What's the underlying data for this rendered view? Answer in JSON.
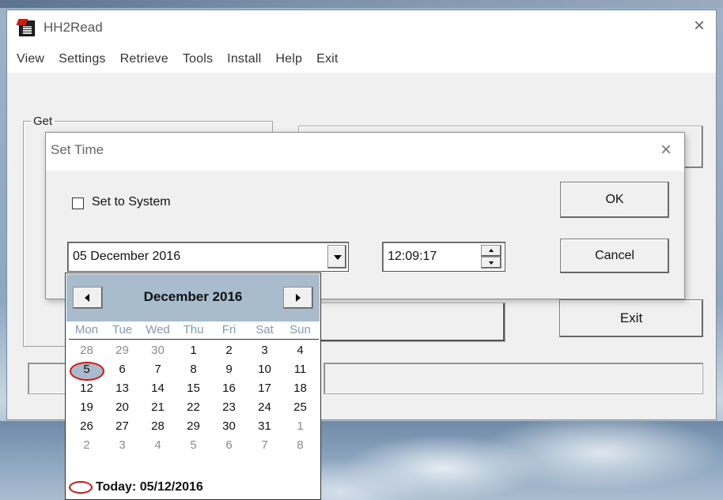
{
  "window": {
    "title": "HH2Read",
    "close_glyph": "×"
  },
  "menu": {
    "items": [
      "View",
      "Settings",
      "Retrieve",
      "Tools",
      "Install",
      "Help",
      "Exit"
    ]
  },
  "main": {
    "group_label": "Get",
    "exit_button": "Exit"
  },
  "dialog": {
    "title": "Set Time",
    "close_glyph": "×",
    "checkbox_label": "Set to System",
    "checkbox_checked": false,
    "ok_label": "OK",
    "cancel_label": "Cancel",
    "date_value": "05 December 2016",
    "time_value": "12:09:17"
  },
  "calendar": {
    "month_label": "December 2016",
    "weekdays": [
      "Mon",
      "Tue",
      "Wed",
      "Thu",
      "Fri",
      "Sat",
      "Sun"
    ],
    "weeks": [
      [
        "28",
        "29",
        "30",
        "1",
        "2",
        "3",
        "4"
      ],
      [
        "5",
        "6",
        "7",
        "8",
        "9",
        "10",
        "11"
      ],
      [
        "12",
        "13",
        "14",
        "15",
        "16",
        "17",
        "18"
      ],
      [
        "19",
        "20",
        "21",
        "22",
        "23",
        "24",
        "25"
      ],
      [
        "26",
        "27",
        "28",
        "29",
        "30",
        "31",
        "1"
      ],
      [
        "2",
        "3",
        "4",
        "5",
        "6",
        "7",
        "8"
      ]
    ],
    "selected_day": "5",
    "today_label": "Today: 05/12/2016"
  },
  "colors": {
    "calendar_header": "#a8bccd",
    "weekday_text": "#7f9ab5",
    "selection_ring": "#e01010"
  }
}
